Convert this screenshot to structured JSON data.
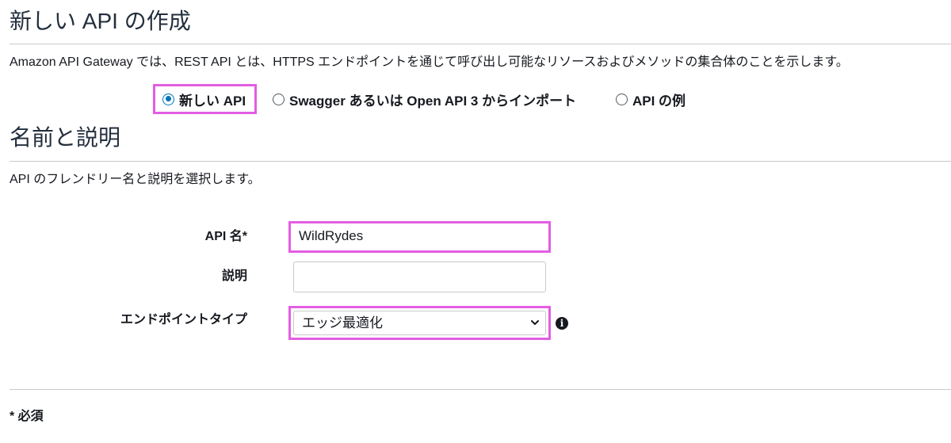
{
  "create_api": {
    "title": "新しい API の作成",
    "description": "Amazon API Gateway では、REST API とは、HTTPS エンドポイントを通じて呼び出し可能なリソースおよびメソッドの集合体のことを示します。",
    "options": [
      {
        "label": "新しい API",
        "selected": true
      },
      {
        "label": "Swagger あるいは Open API 3 からインポート",
        "selected": false
      },
      {
        "label": "API の例",
        "selected": false
      }
    ]
  },
  "name_section": {
    "title": "名前と説明",
    "description": "API のフレンドリー名と説明を選択します。",
    "api_name_label": "API 名*",
    "api_name_value": "WildRydes",
    "description_label": "説明",
    "description_value": "",
    "endpoint_type_label": "エンドポイントタイプ",
    "endpoint_type_value": "エッジ最適化",
    "info_icon": "info-icon"
  },
  "footer": {
    "required_note": "* 必須"
  },
  "colors": {
    "highlight": "#e35ee3",
    "radio_selected": "#0073bb"
  }
}
